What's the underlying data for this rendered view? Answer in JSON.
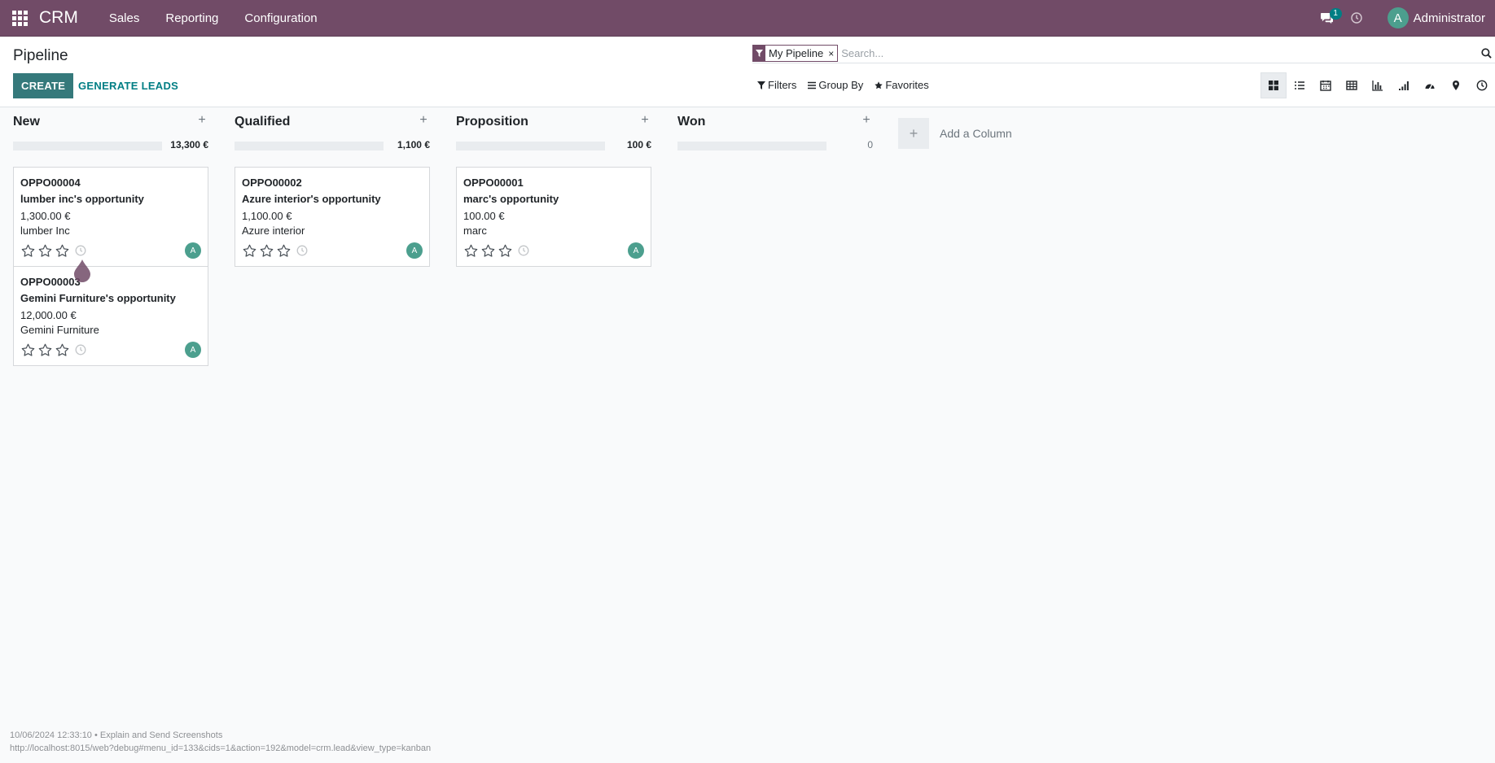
{
  "navbar": {
    "brand": "CRM",
    "menu": [
      "Sales",
      "Reporting",
      "Configuration"
    ],
    "chat_count": "1",
    "user_initial": "A",
    "user_name": "Administrator",
    "bg_color": "#714b67"
  },
  "control_panel": {
    "title": "Pipeline",
    "create_label": "CREATE",
    "generate_label": "GENERATE LEADS",
    "search": {
      "facet_label": "My Pipeline",
      "facet_remove": "×",
      "placeholder": "Search..."
    },
    "filters": [
      "Filters",
      "Group By",
      "Favorites"
    ],
    "views": [
      "kanban-view",
      "list-view",
      "calendar-view",
      "pivot-view",
      "graph-view",
      "cohort-view",
      "dashboard-view",
      "map-view",
      "activity-view"
    ],
    "active_view": "kanban-view"
  },
  "columns": [
    {
      "title": "New",
      "total": "13,300 €",
      "cards": [
        {
          "ref": "OPPO00004",
          "name": "lumber inc's opportunity",
          "amount": "1,300.00 €",
          "company": "lumber Inc",
          "avatar": "A"
        },
        {
          "ref": "OPPO00003",
          "name": "Gemini Furniture's opportunity",
          "amount": "12,000.00 €",
          "company": "Gemini Furniture",
          "avatar": "A"
        }
      ]
    },
    {
      "title": "Qualified",
      "total": "1,100 €",
      "cards": [
        {
          "ref": "OPPO00002",
          "name": "Azure interior's opportunity",
          "amount": "1,100.00 €",
          "company": "Azure interior",
          "avatar": "A"
        }
      ]
    },
    {
      "title": "Proposition",
      "total": "100 €",
      "cards": [
        {
          "ref": "OPPO00001",
          "name": "marc's opportunity",
          "amount": "100.00 €",
          "company": "marc",
          "avatar": "A"
        }
      ]
    },
    {
      "title": "Won",
      "total": "0",
      "cards": []
    }
  ],
  "add_column_label": "Add a Column",
  "col_add_symbol": "+",
  "footer": {
    "timestamp_line": "10/06/2024 12:33:10 • Explain and Send Screenshots",
    "url_line": "http://localhost:8015/web?debug#menu_id=133&cids=1&action=192&model=crm.lead&view_type=kanban"
  }
}
